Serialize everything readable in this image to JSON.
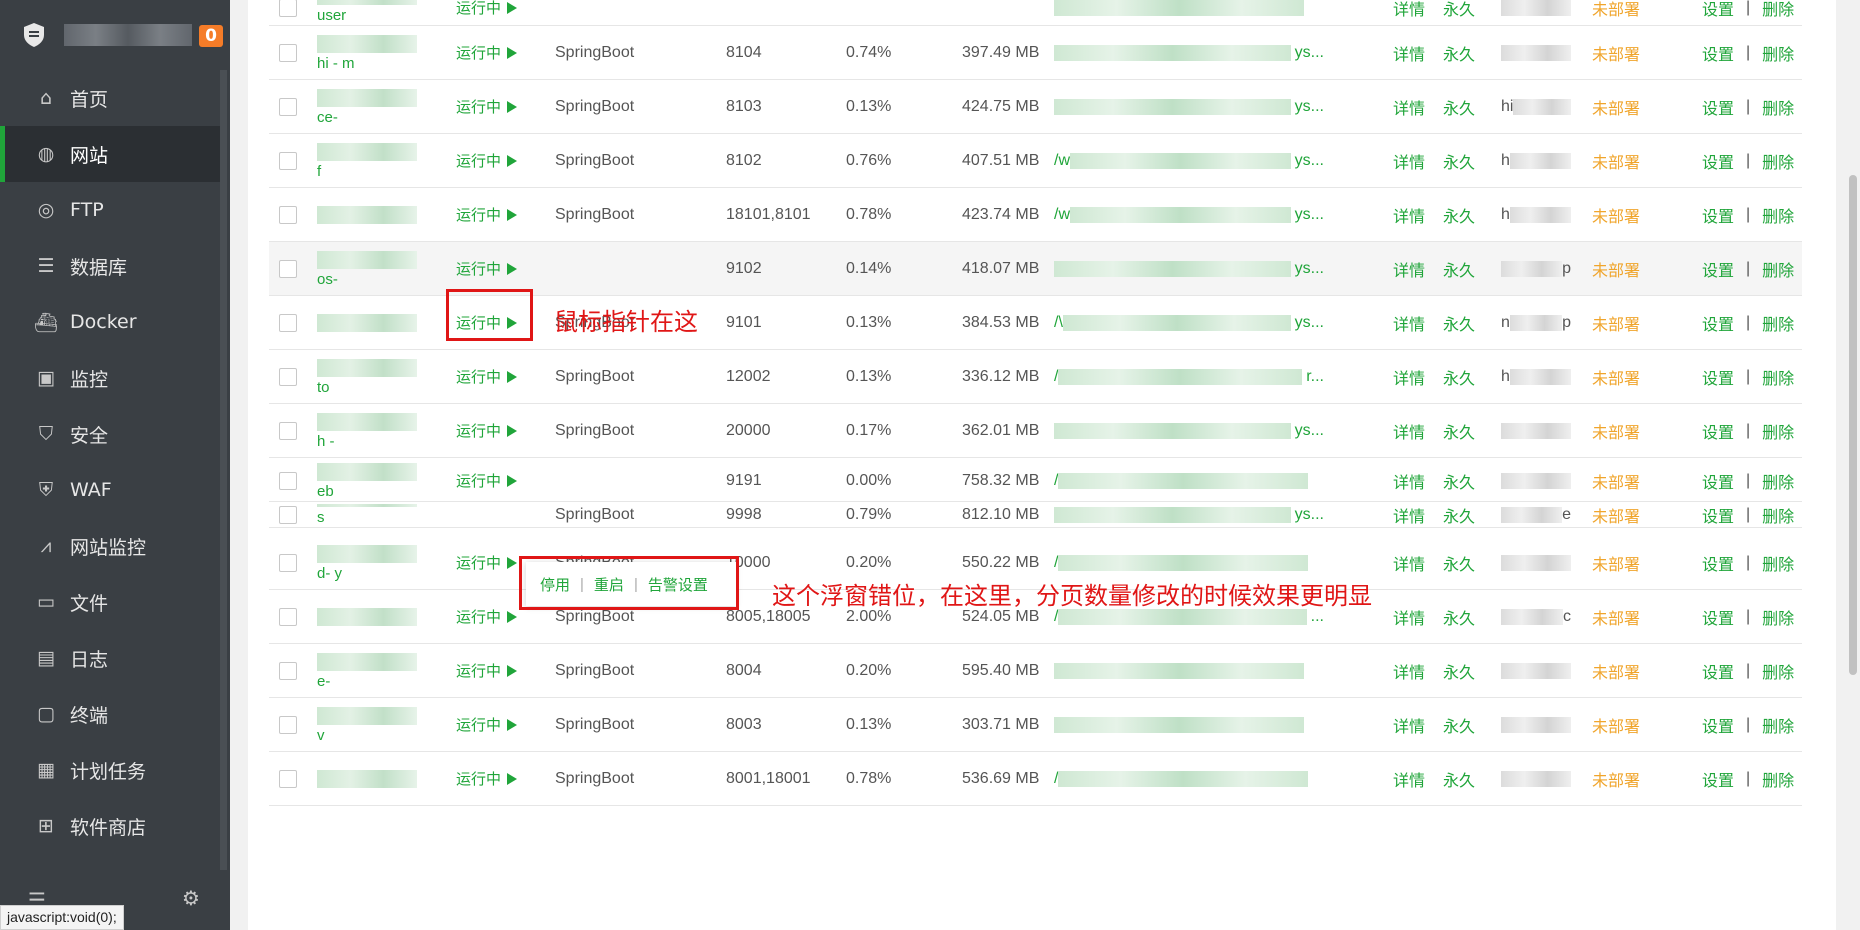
{
  "brand": {
    "badge": "0"
  },
  "nav": [
    {
      "label": "首页",
      "icon": "home-icon"
    },
    {
      "label": "网站",
      "icon": "globe-icon",
      "active": true
    },
    {
      "label": "FTP",
      "icon": "ftp-globe-icon"
    },
    {
      "label": "数据库",
      "icon": "database-icon"
    },
    {
      "label": "Docker",
      "icon": "docker-icon"
    },
    {
      "label": "监控",
      "icon": "monitor-chart-icon"
    },
    {
      "label": "安全",
      "icon": "shield-icon"
    },
    {
      "label": "WAF",
      "icon": "waf-shield-icon"
    },
    {
      "label": "网站监控",
      "icon": "line-chart-icon"
    },
    {
      "label": "文件",
      "icon": "folder-icon"
    },
    {
      "label": "日志",
      "icon": "log-icon"
    },
    {
      "label": "终端",
      "icon": "terminal-icon"
    },
    {
      "label": "计划任务",
      "icon": "calendar-icon"
    },
    {
      "label": "软件商店",
      "icon": "app-store-icon"
    }
  ],
  "status_url": "javascript:void(0);",
  "labels": {
    "detail": "详情",
    "perm": "永久",
    "deploy": "未部署",
    "settings": "设置",
    "sep": "|",
    "delete": "删除"
  },
  "rows": [
    {
      "name": "user",
      "status": "运行中",
      "type": "",
      "port": "",
      "cpu": "",
      "mem": "",
      "path_suffix": ""
    },
    {
      "name": "hi - m",
      "status": "运行中",
      "type": "SpringBoot",
      "port": "8104",
      "cpu": "0.74%",
      "mem": "397.49 MB",
      "path_suffix": "ys..."
    },
    {
      "name": "ce-",
      "status": "运行中",
      "type": "SpringBoot",
      "port": "8103",
      "cpu": "0.13%",
      "mem": "424.75 MB",
      "path_suffix": "ys...",
      "ssl_prefix": "hi"
    },
    {
      "name": "f",
      "status": "运行中",
      "type": "SpringBoot",
      "port": "8102",
      "cpu": "0.76%",
      "mem": "407.51 MB",
      "path_prefix": "/w",
      "path_suffix": "ys...",
      "ssl_prefix": "h"
    },
    {
      "name": "",
      "status": "运行中",
      "type": "SpringBoot",
      "port": "18101,8101",
      "cpu": "0.78%",
      "mem": "423.74 MB",
      "path_prefix": "/w",
      "path_suffix": "ys...",
      "ssl_prefix": "h"
    },
    {
      "name": "os-",
      "status": "运行中",
      "type": "",
      "port": "9102",
      "cpu": "0.14%",
      "mem": "418.07 MB",
      "path_suffix": "ys...",
      "ssl_suffix": "p"
    },
    {
      "name": "",
      "status": "运行中",
      "type": "SpringBoot",
      "port": "9101",
      "cpu": "0.13%",
      "mem": "384.53 MB",
      "path_prefix": "/\\",
      "path_suffix": "ys...",
      "ssl_prefix": "n",
      "ssl_suffix": "p"
    },
    {
      "name": "to",
      "status": "运行中",
      "type": "SpringBoot",
      "port": "12002",
      "cpu": "0.13%",
      "mem": "336.12 MB",
      "path_prefix": "/",
      "path_suffix": "r...",
      "ssl_prefix": "h"
    },
    {
      "name": "h -",
      "status": "运行中",
      "type": "SpringBoot",
      "port": "20000",
      "cpu": "0.17%",
      "mem": "362.01 MB",
      "path_suffix": "ys..."
    },
    {
      "name": "eb",
      "status": "运行中",
      "type": "",
      "port": "9191",
      "cpu": "0.00%",
      "mem": "758.32 MB",
      "path_prefix": "/",
      "path_suffix": ""
    },
    {
      "name": "s",
      "status": "",
      "type": "SpringBoot",
      "port": "9998",
      "cpu": "0.79%",
      "mem": "812.10 MB",
      "path_suffix": "ys...",
      "ssl_suffix": "e"
    },
    {
      "name": "d- y",
      "status": "运行中",
      "type": "SpringBoot",
      "port": "10000",
      "cpu": "0.20%",
      "mem": "550.22 MB",
      "path_prefix": "/",
      "path_suffix": ""
    },
    {
      "name": "",
      "status": "运行中",
      "type": "SpringBoot",
      "port": "8005,18005",
      "cpu": "2.00%",
      "mem": "524.05 MB",
      "path_prefix": "/",
      "path_suffix": "...",
      "ssl_suffix": "c"
    },
    {
      "name": "e-",
      "status": "运行中",
      "type": "SpringBoot",
      "port": "8004",
      "cpu": "0.20%",
      "mem": "595.40 MB",
      "path_suffix": ""
    },
    {
      "name": "v",
      "status": "运行中",
      "type": "SpringBoot",
      "port": "8003",
      "cpu": "0.13%",
      "mem": "303.71 MB",
      "path_suffix": ""
    },
    {
      "name": "",
      "status": "运行中",
      "type": "SpringBoot",
      "port": "8001,18001",
      "cpu": "0.78%",
      "mem": "536.69 MB",
      "path_prefix": "/",
      "path_suffix": ""
    }
  ],
  "popup": {
    "stop": "停用",
    "restart": "重启",
    "alert": "告警设置",
    "sep": "|"
  },
  "annotations": {
    "pointer_note": "鼠标指针在这",
    "popup_note": "这个浮窗错位，在这里，分页数量修改的时候效果更明显"
  }
}
